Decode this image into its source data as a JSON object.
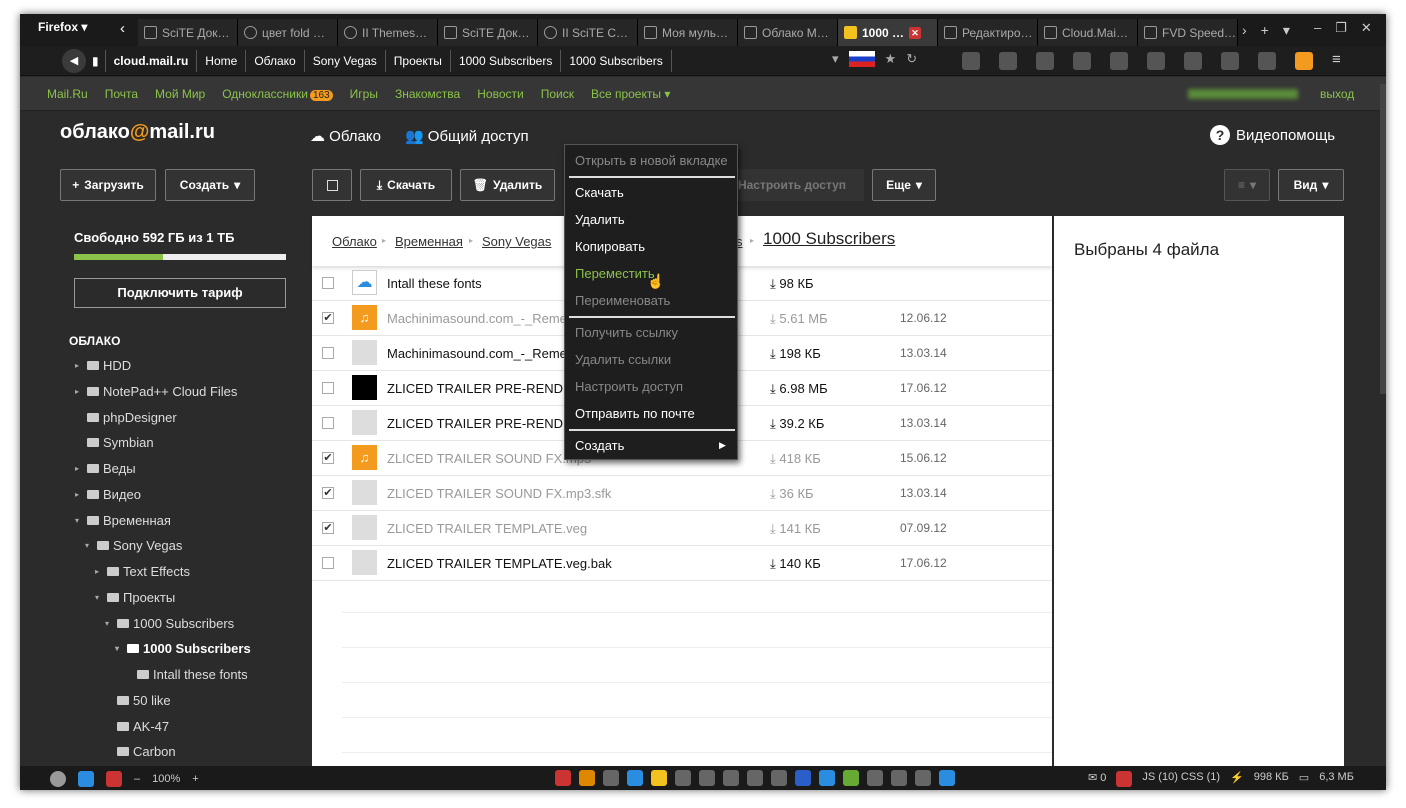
{
  "browser": {
    "menu_label": "Firefox ▾",
    "tabs": [
      {
        "label": "SciTE Док…"
      },
      {
        "label": "цвет fold …"
      },
      {
        "label": "II Themes…"
      },
      {
        "label": "SciTE Док…"
      },
      {
        "label": "II SciTE C…"
      },
      {
        "label": "Моя муль…"
      },
      {
        "label": "Облако М…"
      },
      {
        "label": "1000 …"
      },
      {
        "label": "Редактиро…"
      },
      {
        "label": "Cloud.Mai…"
      },
      {
        "label": "FVD Speed…"
      }
    ],
    "url_crumbs": [
      "cloud.mail.ru",
      "Home",
      "Облако",
      "Sony Vegas",
      "Проекты",
      "1000 Subscribers",
      "1000 Subscribers"
    ]
  },
  "bookmarks": {
    "items": [
      "Mail.Ru",
      "Почта",
      "Мой Мир",
      "Одноклассники",
      "Игры",
      "Знакомства",
      "Новости",
      "Поиск",
      "Все проекты ▾"
    ],
    "ok_badge": "163",
    "logout": "выход"
  },
  "header": {
    "logo_a": "облако",
    "logo_at": "@",
    "logo_b": "mail.ru",
    "nav_cloud": "Облако",
    "nav_share": "Общий доступ",
    "help": "Видеопомощь"
  },
  "toolbar": {
    "upload": "Загрузить",
    "create": "Создать",
    "download": "Скачать",
    "delete": "Удалить",
    "access": "Настроить доступ",
    "more": "Еще",
    "view": "Вид"
  },
  "sidebar": {
    "quota": "Свободно 592 ГБ из 1 ТБ",
    "quota_fraction": 0.42,
    "plan_button": "Подключить тариф",
    "section": "ОБЛАКО",
    "tree": [
      {
        "label": "HDD"
      },
      {
        "label": "NotePad++ Cloud Files"
      },
      {
        "label": "phpDesigner"
      },
      {
        "label": "Symbian"
      },
      {
        "label": "Веды"
      },
      {
        "label": "Видео"
      },
      {
        "label": "Временная"
      },
      {
        "label": "Sony Vegas"
      },
      {
        "label": "Text Effects"
      },
      {
        "label": "Проекты"
      },
      {
        "label": "1000 Subscribers"
      },
      {
        "label": "1000 Subscribers"
      },
      {
        "label": "Intall these fonts"
      },
      {
        "label": "50 like"
      },
      {
        "label": "AK-47"
      },
      {
        "label": "Carbon"
      }
    ]
  },
  "breadcrumb": {
    "items": [
      "Облако",
      "Временная",
      "Sony Vegas",
      "s"
    ],
    "current": "1000 Subscribers"
  },
  "files": [
    {
      "name": "Intall these fonts",
      "size": "98 КБ",
      "date": "",
      "checked": false
    },
    {
      "name": "Machinimasound.com_-_Reme",
      "size": "5.61 МБ",
      "date": "12.06.12",
      "checked": true
    },
    {
      "name": "Machinimasound.com_-_Reme",
      "size": "198 КБ",
      "date": "13.03.14",
      "checked": false
    },
    {
      "name": "ZLICED TRAILER PRE-RENDE",
      "size": "6.98 МБ",
      "date": "17.06.12",
      "checked": false
    },
    {
      "name": "ZLICED TRAILER PRE-RENDE",
      "size": "39.2 КБ",
      "date": "13.03.14",
      "checked": false
    },
    {
      "name": "ZLICED TRAILER SOUND FX.mp3",
      "size": "418 КБ",
      "date": "15.06.12",
      "checked": true
    },
    {
      "name": "ZLICED TRAILER SOUND FX.mp3.sfk",
      "size": "36 КБ",
      "date": "13.03.14",
      "checked": true
    },
    {
      "name": "ZLICED TRAILER TEMPLATE.veg",
      "size": "141 КБ",
      "date": "07.09.12",
      "checked": true
    },
    {
      "name": "ZLICED TRAILER TEMPLATE.veg.bak",
      "size": "140 КБ",
      "date": "17.06.12",
      "checked": false
    }
  ],
  "info": {
    "title": "Выбраны 4 файла"
  },
  "context_menu": {
    "open_new_tab": "Открыть в новой вкладке",
    "download": "Скачать",
    "delete": "Удалить",
    "copy": "Копировать",
    "move": "Переместить",
    "rename": "Переименовать",
    "get_link": "Получить ссылку",
    "delete_links": "Удалить ссылки",
    "access": "Настроить доступ",
    "send_mail": "Отправить по почте",
    "create": "Создать"
  },
  "statusbar": {
    "zoom": "100%",
    "mail_count": "0",
    "js_css": "JS (10) CSS (1)",
    "mem1": "998 КБ",
    "mem2": "6,3 МБ"
  },
  "colors": {
    "accent_green": "#8bc34a",
    "accent_orange": "#f29b1e",
    "dark_bg": "#2b2b2b"
  }
}
